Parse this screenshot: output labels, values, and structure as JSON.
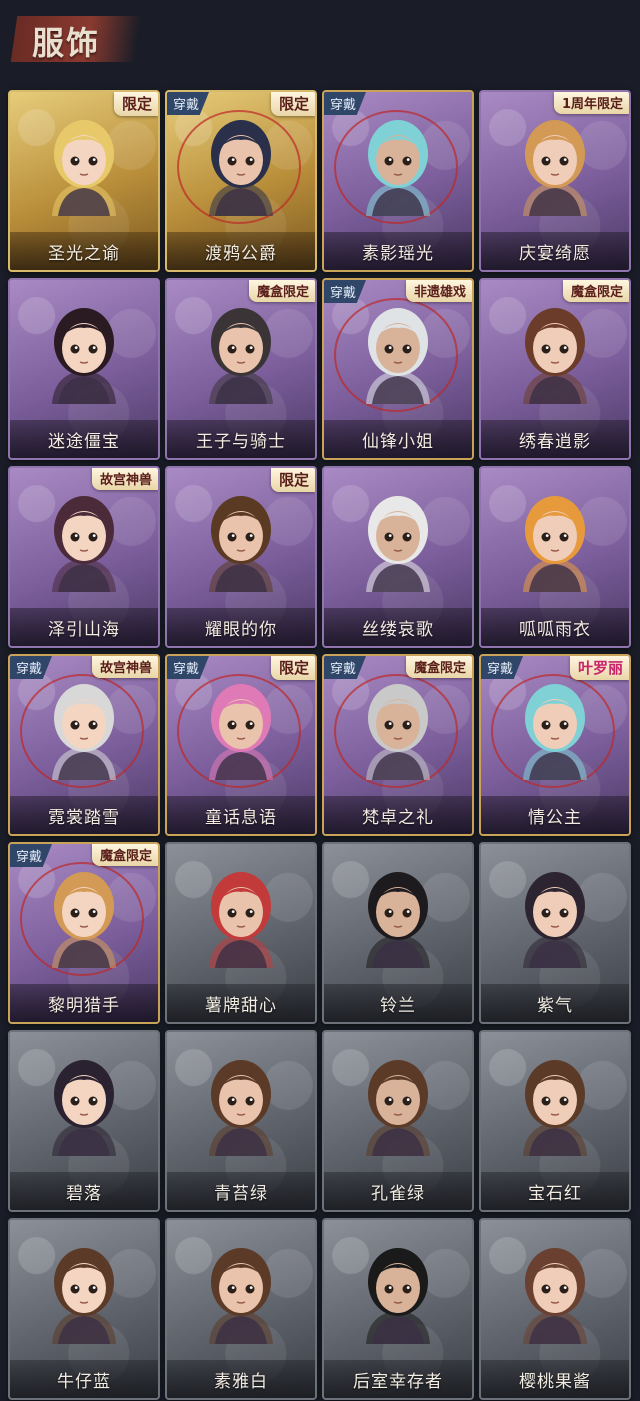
{
  "header": {
    "title": "服饰"
  },
  "colors": {
    "background": "#1a1d27",
    "gold": "#c9a35a",
    "purple": "#7b5e9b",
    "gray": "#5f636c",
    "worn_badge": "#2f4668"
  },
  "costumes": [
    {
      "name": "圣光之谕",
      "tier": "gold",
      "worn": false,
      "tag": "限定"
    },
    {
      "name": "渡鸦公爵",
      "tier": "gold",
      "worn": true,
      "tag": "限定"
    },
    {
      "name": "素影瑶光",
      "tier": "purple",
      "worn": true,
      "tag": ""
    },
    {
      "name": "庆宴绮愿",
      "tier": "purple",
      "worn": false,
      "tag": "1周年限定"
    },
    {
      "name": "迷途僵宝",
      "tier": "purple",
      "worn": false,
      "tag": ""
    },
    {
      "name": "王子与骑士",
      "tier": "purple",
      "worn": false,
      "tag": "魔盒限定"
    },
    {
      "name": "仙锋小姐",
      "tier": "purple",
      "worn": true,
      "tag": "非遗雄戏"
    },
    {
      "name": "绣春逍影",
      "tier": "purple",
      "worn": false,
      "tag": "魔盒限定"
    },
    {
      "name": "泽引山海",
      "tier": "purple",
      "worn": false,
      "tag": "故宫神兽"
    },
    {
      "name": "耀眼的你",
      "tier": "purple",
      "worn": false,
      "tag": "限定"
    },
    {
      "name": "丝缕哀歌",
      "tier": "purple",
      "worn": false,
      "tag": ""
    },
    {
      "name": "呱呱雨衣",
      "tier": "purple",
      "worn": false,
      "tag": ""
    },
    {
      "name": "霓裳踏雪",
      "tier": "purple",
      "worn": true,
      "tag": "故宫神兽"
    },
    {
      "name": "童话息语",
      "tier": "purple",
      "worn": true,
      "tag": "限定"
    },
    {
      "name": "梵卓之礼",
      "tier": "purple",
      "worn": true,
      "tag": "魔盒限定"
    },
    {
      "name": "情公主",
      "tier": "purple",
      "worn": true,
      "tag": "叶罗丽"
    },
    {
      "name": "黎明猎手",
      "tier": "purple",
      "worn": true,
      "tag": "魔盒限定"
    },
    {
      "name": "薯牌甜心",
      "tier": "gray",
      "worn": false,
      "tag": ""
    },
    {
      "name": "铃兰",
      "tier": "gray",
      "worn": false,
      "tag": ""
    },
    {
      "name": "紫气",
      "tier": "gray",
      "worn": false,
      "tag": ""
    },
    {
      "name": "碧落",
      "tier": "gray",
      "worn": false,
      "tag": ""
    },
    {
      "name": "青苔绿",
      "tier": "gray",
      "worn": false,
      "tag": ""
    },
    {
      "name": "孔雀绿",
      "tier": "gray",
      "worn": false,
      "tag": ""
    },
    {
      "name": "宝石红",
      "tier": "gray",
      "worn": false,
      "tag": ""
    },
    {
      "name": "牛仔蓝",
      "tier": "gray",
      "worn": false,
      "tag": ""
    },
    {
      "name": "素雅白",
      "tier": "gray",
      "worn": false,
      "tag": ""
    },
    {
      "name": "后室幸存者",
      "tier": "gray",
      "worn": false,
      "tag": ""
    },
    {
      "name": "樱桃果酱",
      "tier": "gray",
      "worn": false,
      "tag": ""
    }
  ],
  "worn_label": "穿戴"
}
